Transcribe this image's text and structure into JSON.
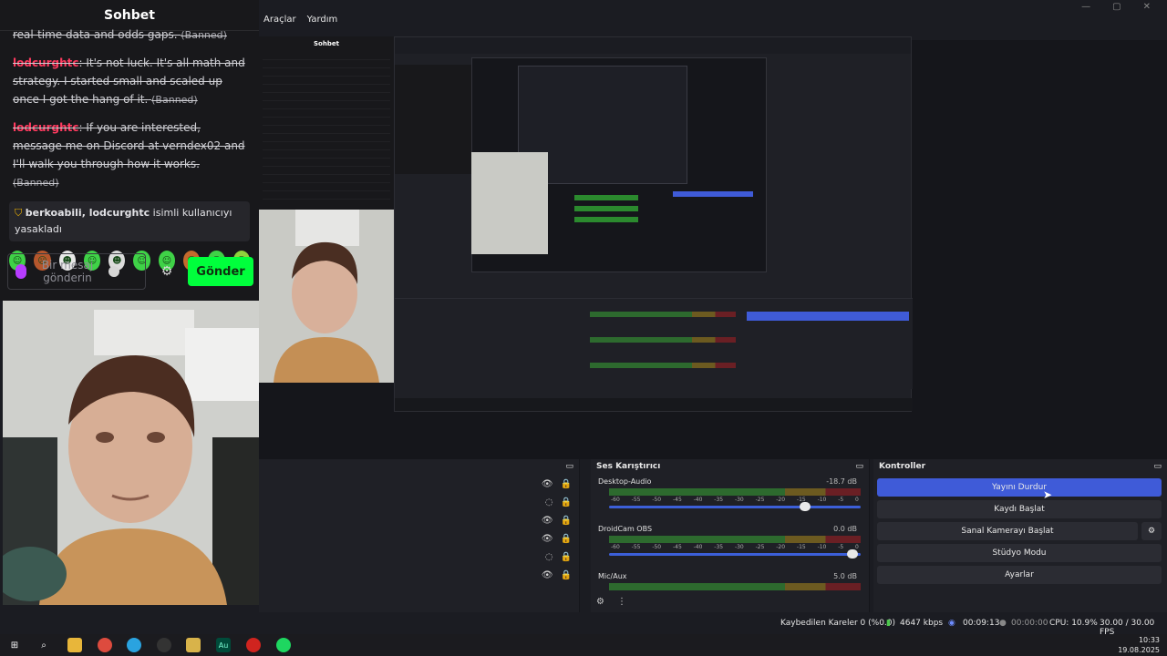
{
  "menu": [
    "Araçlar",
    "Yardım"
  ],
  "chat": {
    "title": "Sohbet",
    "messages": [
      {
        "user": "",
        "text": "real-time data and odds gaps.",
        "banned": "(Banned)"
      },
      {
        "user": "lodcurghtc",
        "text": ": It's not luck. It's all math and strategy. I started small and scaled up once I got the hang of it.",
        "banned": "(Banned)"
      },
      {
        "user": "lodcurghtc",
        "text": ": If you are interested, message me on Discord at verndex02 and I'll walk you through how it works.",
        "banned": "(Banned)"
      }
    ],
    "notice_users": "berkoabili, lodcurghtc",
    "notice_text": " isimli kullanıcıyı yasakladı",
    "placeholder": "Bir mesaj gönderin",
    "send_label": "Gönder"
  },
  "mixer": {
    "title": "Ses Karıştırıcı",
    "tracks": [
      {
        "name": "Desktop-Audio",
        "db": "-18.7 dB",
        "level": 0.79
      },
      {
        "name": "DroidCam OBS",
        "db": "0.0 dB",
        "level": 0.99
      },
      {
        "name": "Mic/Aux",
        "db": "5.0 dB",
        "level": 0.99
      }
    ],
    "scale": [
      "-60",
      "-55",
      "-50",
      "-45",
      "-40",
      "-35",
      "-30",
      "-25",
      "-20",
      "-15",
      "-10",
      "-5",
      "0"
    ]
  },
  "controls": {
    "title": "Kontroller",
    "buttons": [
      "Yayını Durdur",
      "Kaydı Başlat",
      "Sanal Kamerayı Başlat",
      "Stüdyo Modu",
      "Ayarlar"
    ]
  },
  "status": {
    "dropped": "Kaybedilen Kareler 0 (%0.0)",
    "bitrate": "4647 kbps",
    "stream_time": "00:09:13",
    "record_time": "00:00:00",
    "cpu": "CPU: 10.9%",
    "fps": "30.00 / 30.00 FPS"
  },
  "clock": {
    "time": "10:33",
    "date": "19.08.2025"
  },
  "colors": {
    "accent": "#3f5bd8",
    "send": "#00ff3c",
    "banned_user": "#ff3a5f"
  }
}
